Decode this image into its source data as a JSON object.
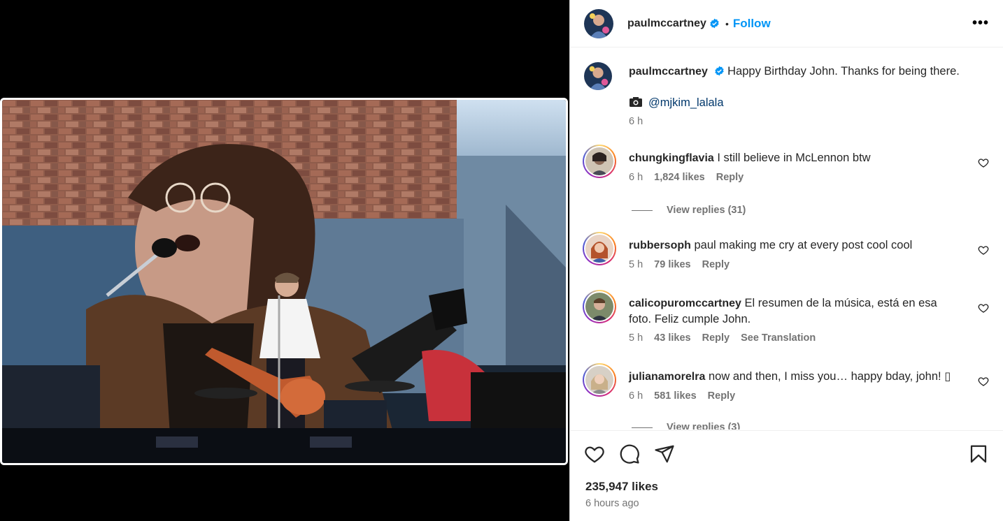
{
  "post": {
    "author": "paulmccartney",
    "follow_label": "Follow",
    "dot": "•",
    "more_label": "•••",
    "caption": {
      "username": "paulmccartney",
      "text": "Happy Birthday John. Thanks for being there.",
      "photo_credit": "@mjkim_lalala",
      "time": "6 h"
    },
    "likes": "235,947 likes",
    "posted_ago": "6 hours ago"
  },
  "comments": [
    {
      "username": "chungkingflavia",
      "text": "I still believe in McLennon btw",
      "time": "6 h",
      "likes": "1,824 likes",
      "reply": "Reply",
      "view_replies": "View replies (31)"
    },
    {
      "username": "rubbersoph",
      "text": "paul making me cry at every post cool cool",
      "time": "5 h",
      "likes": "79 likes",
      "reply": "Reply"
    },
    {
      "username": "calicopuromccartney",
      "text": "El resumen de la música, está en esa foto. Feliz cumple John.",
      "time": "5 h",
      "likes": "43 likes",
      "reply": "Reply",
      "see_translation": "See Translation"
    },
    {
      "username": "julianamorelra",
      "text": "now and then, I miss you… happy bday, john! ▯",
      "time": "6 h",
      "likes": "581 likes",
      "reply": "Reply",
      "view_replies": "View replies (3)"
    }
  ],
  "icons": {
    "verified": "verified-badge-icon",
    "like": "heart-icon",
    "comment": "comment-icon",
    "share": "paper-plane-icon",
    "save": "bookmark-icon",
    "camera": "camera-icon"
  },
  "colors": {
    "accent": "#0095f6",
    "verified": "#0095f6",
    "secondary_text": "#737373",
    "mention": "#00376b"
  }
}
